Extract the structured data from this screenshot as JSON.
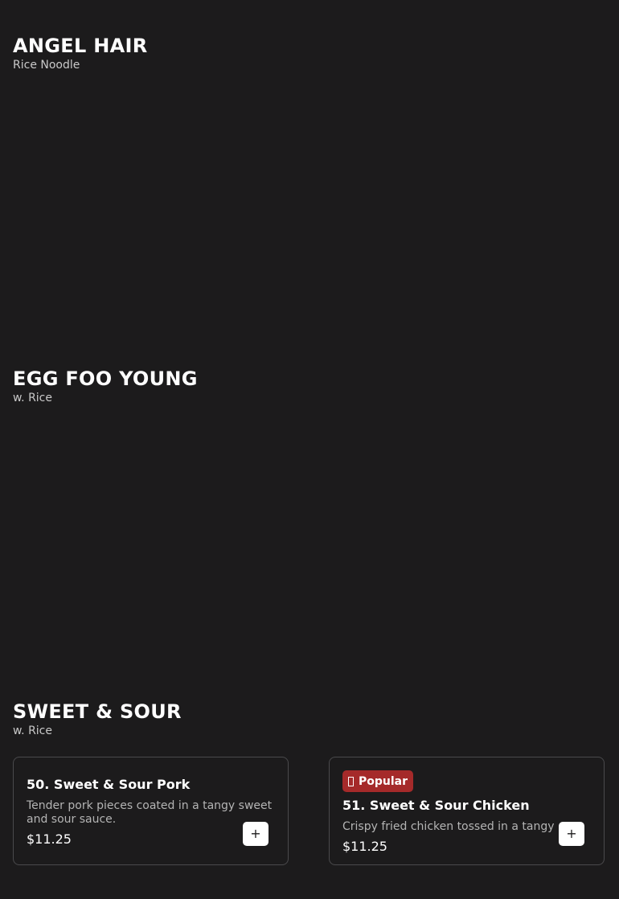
{
  "sections": [
    {
      "title": "ANGEL HAIR",
      "subtitle": "Rice Noodle"
    },
    {
      "title": "EGG FOO YOUNG",
      "subtitle": "w. Rice"
    },
    {
      "title": "SWEET & SOUR",
      "subtitle": "w. Rice"
    }
  ],
  "items": [
    {
      "name": "50. Sweet & Sour Pork",
      "description": "Tender pork pieces coated in a tangy sweet and sour sauce.",
      "price": "$11.25",
      "add_label": "+"
    },
    {
      "badge": "Popular",
      "badge_icon": "flame-icon",
      "name": "51. Sweet & Sour Chicken",
      "description": "Crispy fried chicken tossed in a tangy .",
      "price": "$11.25",
      "add_label": "+"
    }
  ],
  "colors": {
    "background": "#1c1b1c",
    "badge": "#a52a2a",
    "card_border": "#4a4a4c"
  }
}
